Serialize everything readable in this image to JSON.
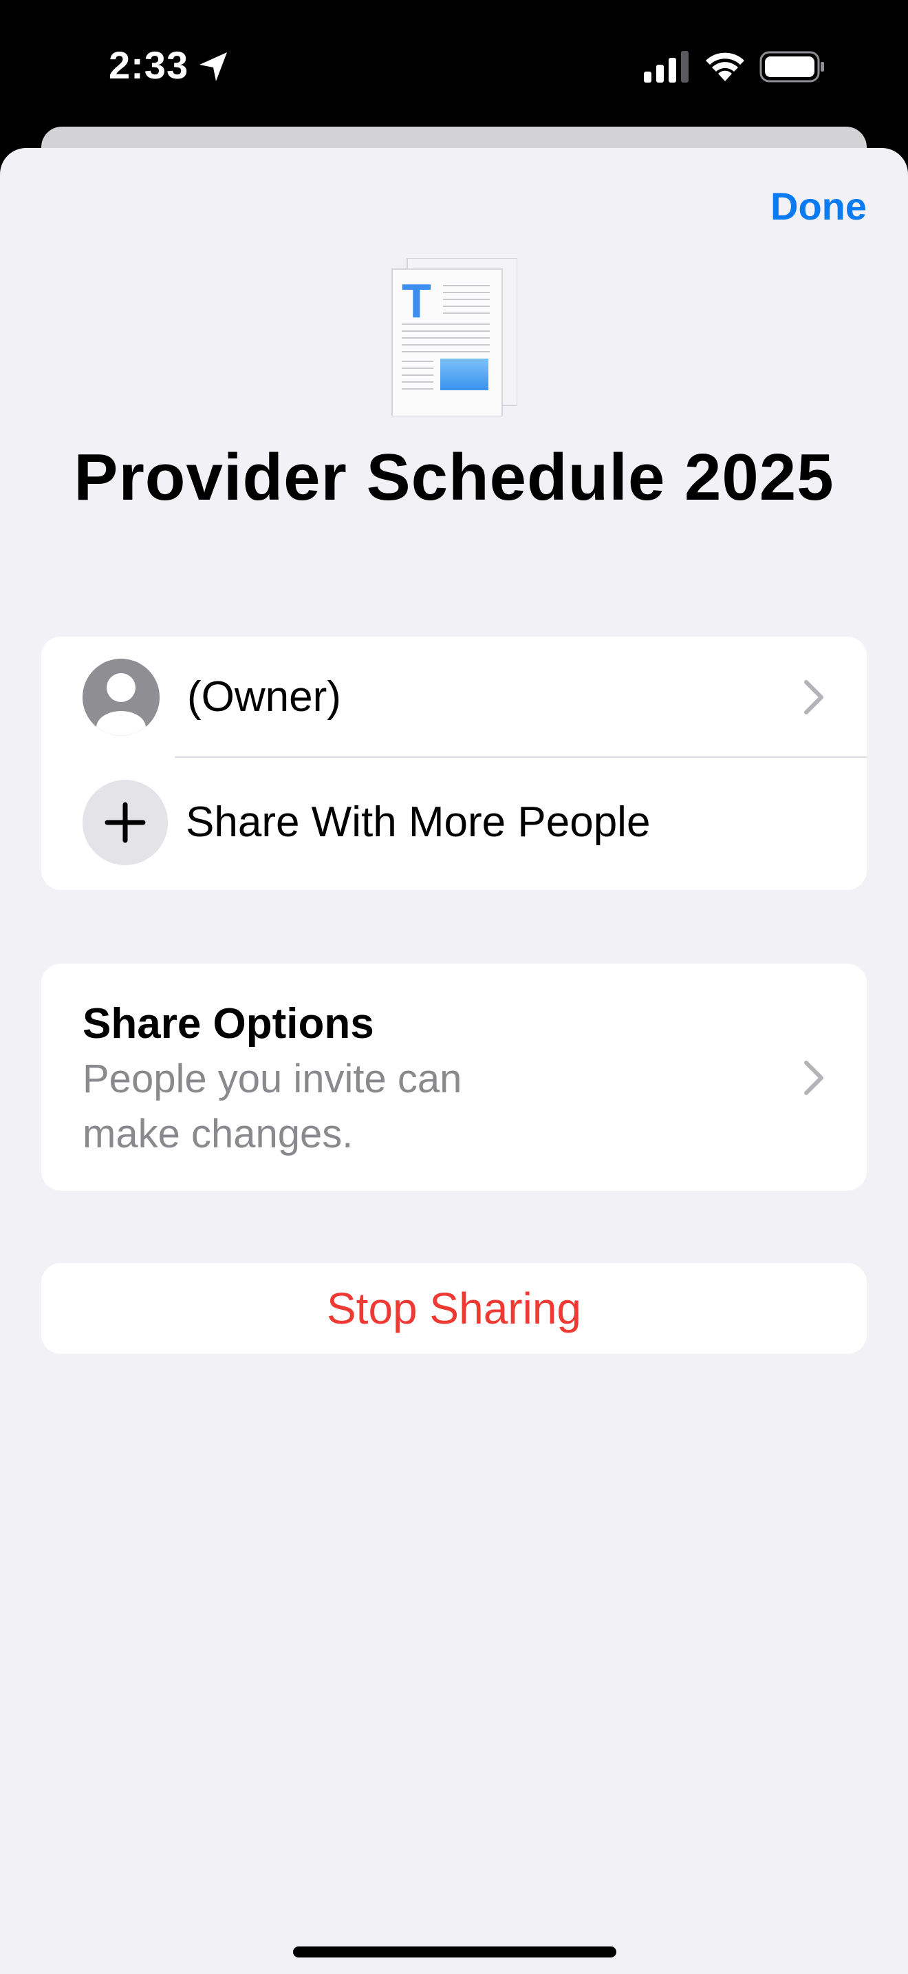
{
  "status_bar": {
    "time": "2:33",
    "icons": [
      "location-arrow-icon",
      "cellular-signal-icon",
      "wifi-icon",
      "battery-icon"
    ]
  },
  "sheet": {
    "done_label": "Done",
    "document_title": "Provider Schedule 2025",
    "document_icon": "pages-document-icon",
    "participants": {
      "owner_label": "(Owner)",
      "share_more_label": "Share With More People"
    },
    "share_options": {
      "title": "Share Options",
      "description": "People you invite can make changes."
    },
    "stop_sharing_label": "Stop Sharing"
  },
  "colors": {
    "accent": "#0b7bf2",
    "destructive": "#ee3a32",
    "sheet_background": "#f1f1f6",
    "secondary_text": "#8a8a8e"
  }
}
